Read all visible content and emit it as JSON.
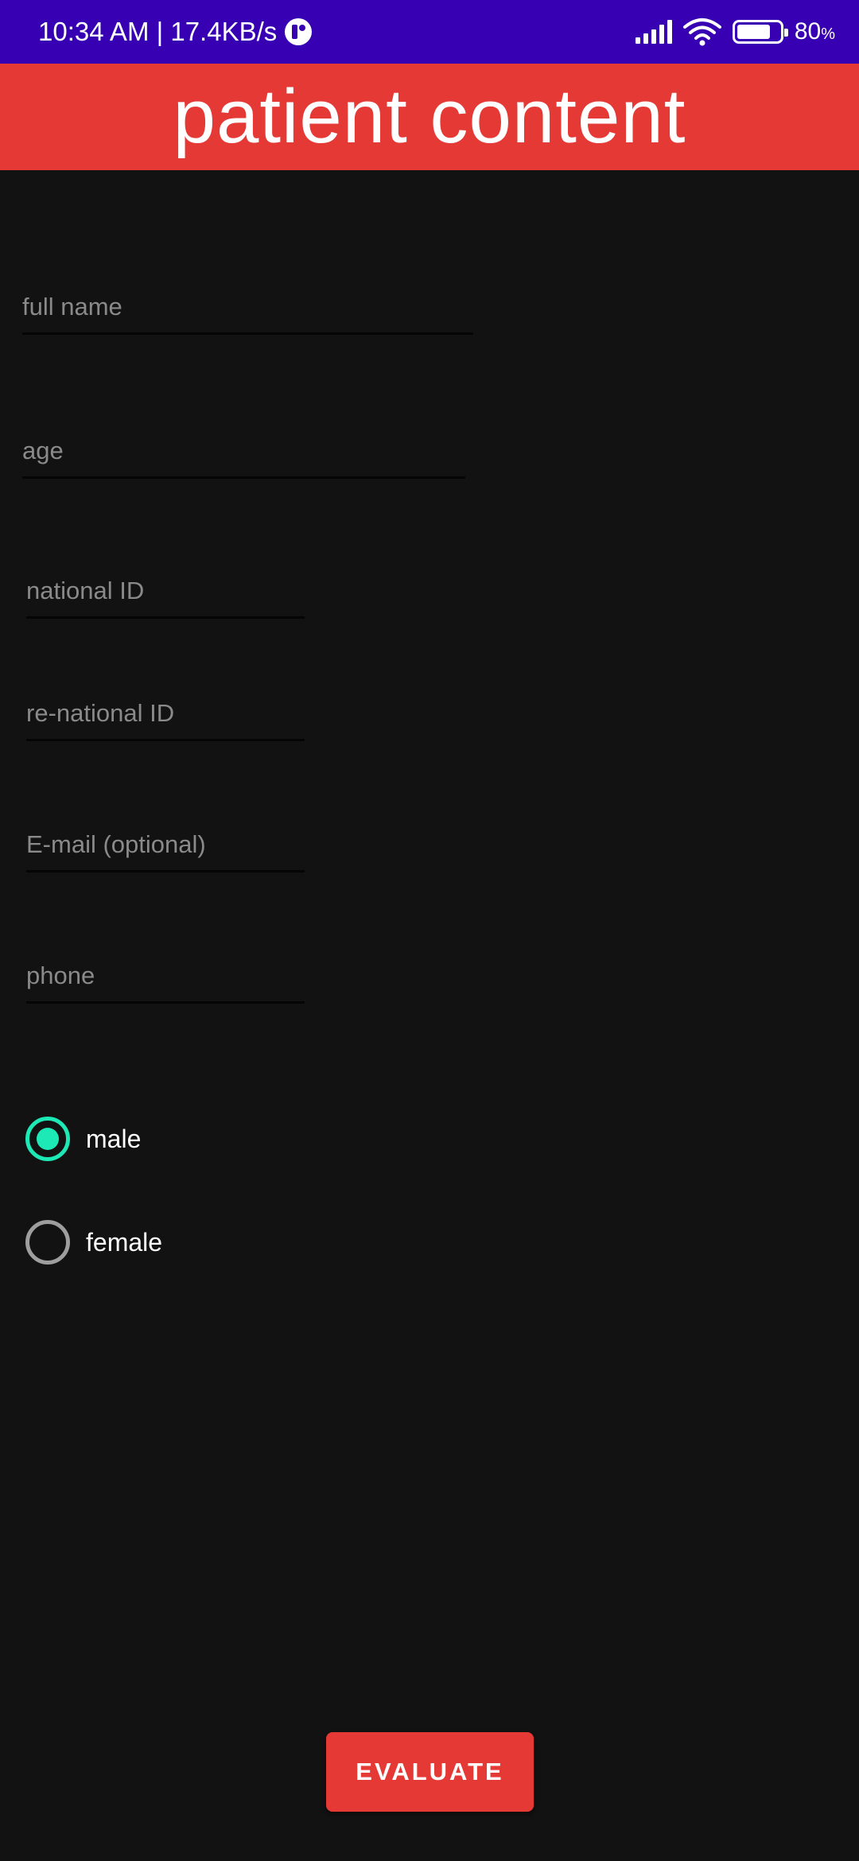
{
  "status_bar": {
    "time_speed": "10:34 AM | 17.4KB/s",
    "battery_level": 0.8,
    "battery_value": "80",
    "battery_pct_sign": "%",
    "icons": [
      "app-notification-icon",
      "signal-icon",
      "wifi-icon",
      "battery-icon"
    ]
  },
  "app_bar": {
    "title": "patient content",
    "color": "#e53935"
  },
  "form": {
    "full_name_placeholder": "full name",
    "age_placeholder": "age",
    "national_id_placeholder": "national ID",
    "re_national_id_placeholder": "re-national ID",
    "email_placeholder": "E-mail (optional)",
    "phone_placeholder": "phone"
  },
  "gender": {
    "male_label": "male",
    "female_label": "female",
    "selected": "male",
    "accent_color": "#1de9b6"
  },
  "actions": {
    "evaluate_label": "EVALUATE"
  }
}
